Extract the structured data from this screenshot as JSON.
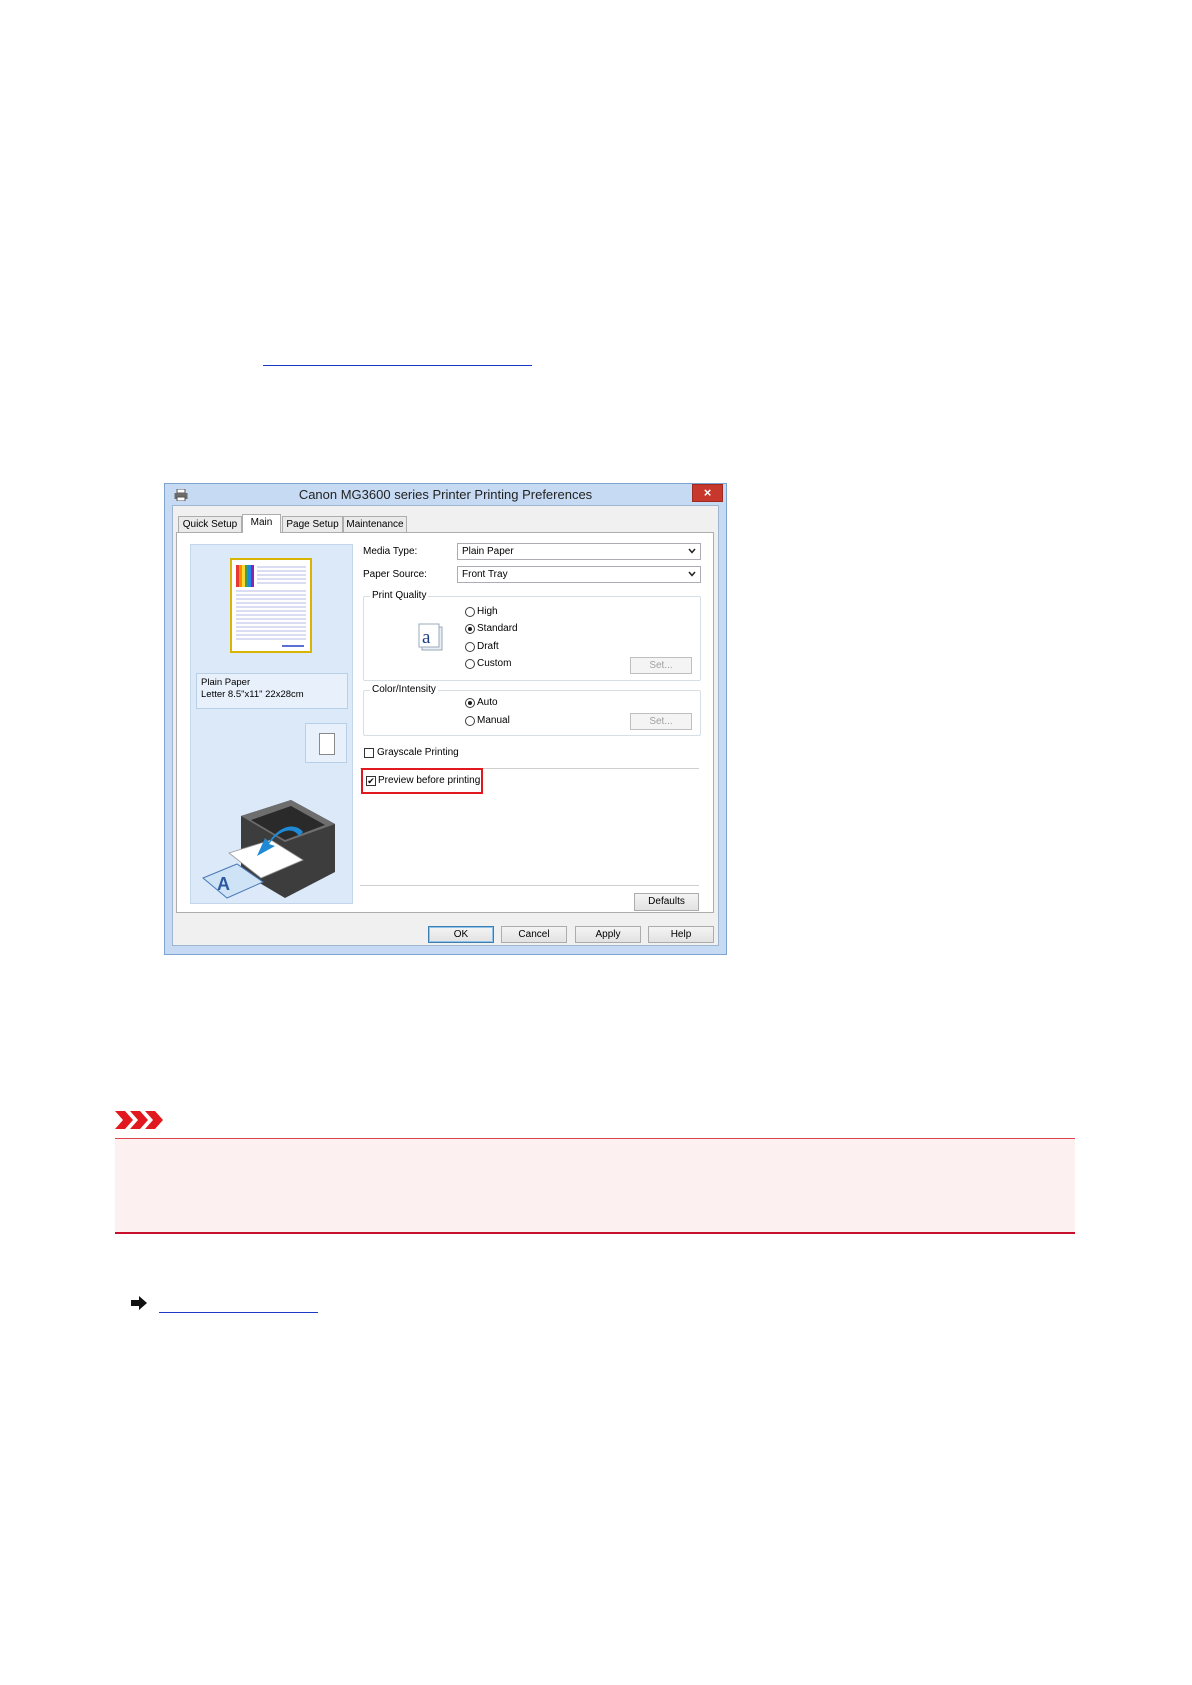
{
  "dialog": {
    "title": "Canon MG3600 series Printer Printing Preferences",
    "close_label": "×",
    "tabs": [
      "Quick Setup",
      "Main",
      "Page Setup",
      "Maintenance"
    ],
    "selected_tab": "Main",
    "paper_info": {
      "line1": "Plain Paper",
      "line2": "Letter 8.5\"x11\" 22x28cm"
    },
    "media_type": {
      "label": "Media Type:",
      "value": "Plain Paper"
    },
    "paper_source": {
      "label": "Paper Source:",
      "value": "Front Tray"
    },
    "print_quality": {
      "label": "Print Quality",
      "options": [
        "High",
        "Standard",
        "Draft",
        "Custom"
      ],
      "selected": "Standard",
      "set_label": "Set..."
    },
    "color_intensity": {
      "label": "Color/Intensity",
      "options": [
        "Auto",
        "Manual"
      ],
      "selected": "Auto",
      "set_label": "Set..."
    },
    "grayscale": {
      "label": "Grayscale Printing",
      "checked": false
    },
    "preview": {
      "label": "Preview before printing",
      "checked": true
    },
    "defaults_label": "Defaults",
    "buttons": {
      "ok": "OK",
      "cancel": "Cancel",
      "apply": "Apply",
      "help": "Help"
    },
    "highlight_color": "#e1191e"
  },
  "important": {
    "icon": "important-icon",
    "accent_color": "#c8102e",
    "background_color": "#fdf0f0"
  },
  "related": {
    "icon": "arrow-right-icon"
  }
}
